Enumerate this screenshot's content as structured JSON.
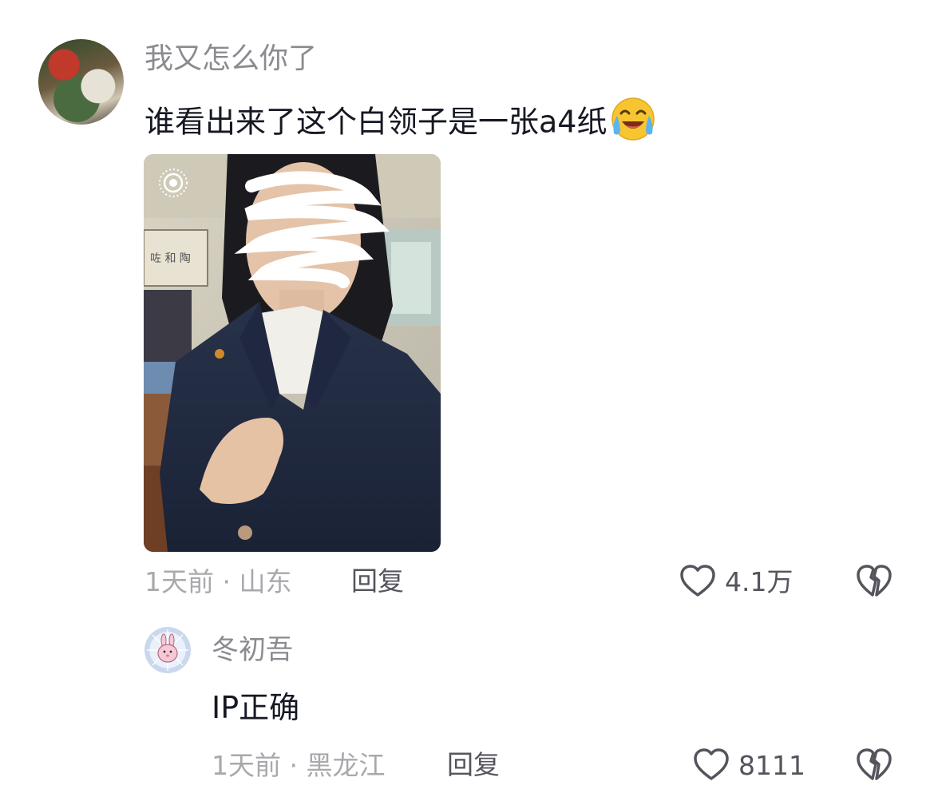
{
  "comment": {
    "username": "我又怎么你了",
    "text": "谁看出来了这个白领子是一张a4纸",
    "emoji": "crying-laughing-emoji",
    "time_location": "1天前 · 山东",
    "reply_label": "回复",
    "likes": "4.1万"
  },
  "reply": {
    "username": "冬初吾",
    "text": "IP正确",
    "time_location": "1天前 · 黑龙江",
    "reply_label": "回复",
    "likes": "8111"
  },
  "icons": {
    "like": "heart-outline-icon",
    "dislike": "broken-heart-icon",
    "live_photo": "live-photo-icon"
  },
  "colors": {
    "text_primary": "#161823",
    "text_secondary": "#8a8b91",
    "text_meta": "#a8a9ad",
    "action": "#54555c",
    "background": "#ffffff"
  }
}
